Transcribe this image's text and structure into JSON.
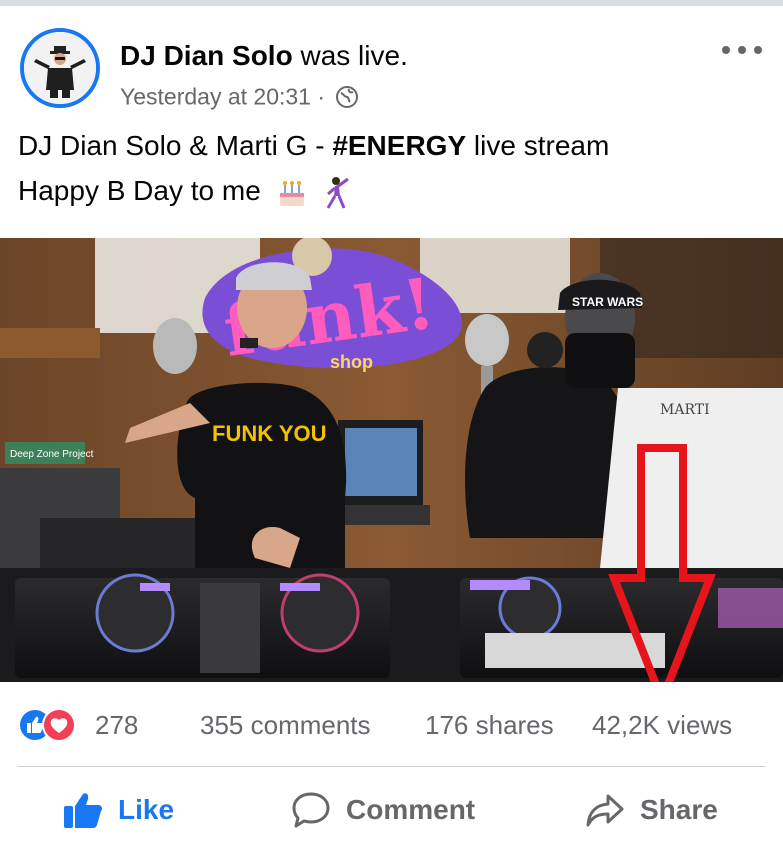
{
  "post": {
    "author": "DJ Dian Solo",
    "action": "was live.",
    "timestamp": "Yesterday at 20:31",
    "separator": "·",
    "privacy_icon": "globe-icon",
    "more_icon": "more-options-icon",
    "text_line1_a": "DJ Dian Solo & Marti G - ",
    "text_line1_hashtag": "#ENERGY",
    "text_line1_b": " live stream",
    "text_line2": "Happy B Day to me",
    "emojis": [
      "birthday-cake-icon",
      "dancing-man-icon"
    ]
  },
  "video": {
    "description_icon": "live-video-thumbnail",
    "scene_texts": {
      "cap_text": "",
      "shirt_text": "FUNK YOU",
      "sign_text": "funk!",
      "sign_sub": "shop",
      "star_wars_cap": "STAR WARS",
      "screen_text": "MARTI",
      "plate_text": "Deep Zone Project"
    },
    "annotation": "red-down-arrow"
  },
  "stats": {
    "reactions_count": "278",
    "comments": "355 comments",
    "shares": "176 shares",
    "views": "42,2K views"
  },
  "actions": {
    "like": "Like",
    "comment": "Comment",
    "share": "Share"
  },
  "colors": {
    "accent": "#1877f2",
    "love": "#f33e58",
    "arrow": "#e8141b",
    "muted": "#65676b"
  }
}
